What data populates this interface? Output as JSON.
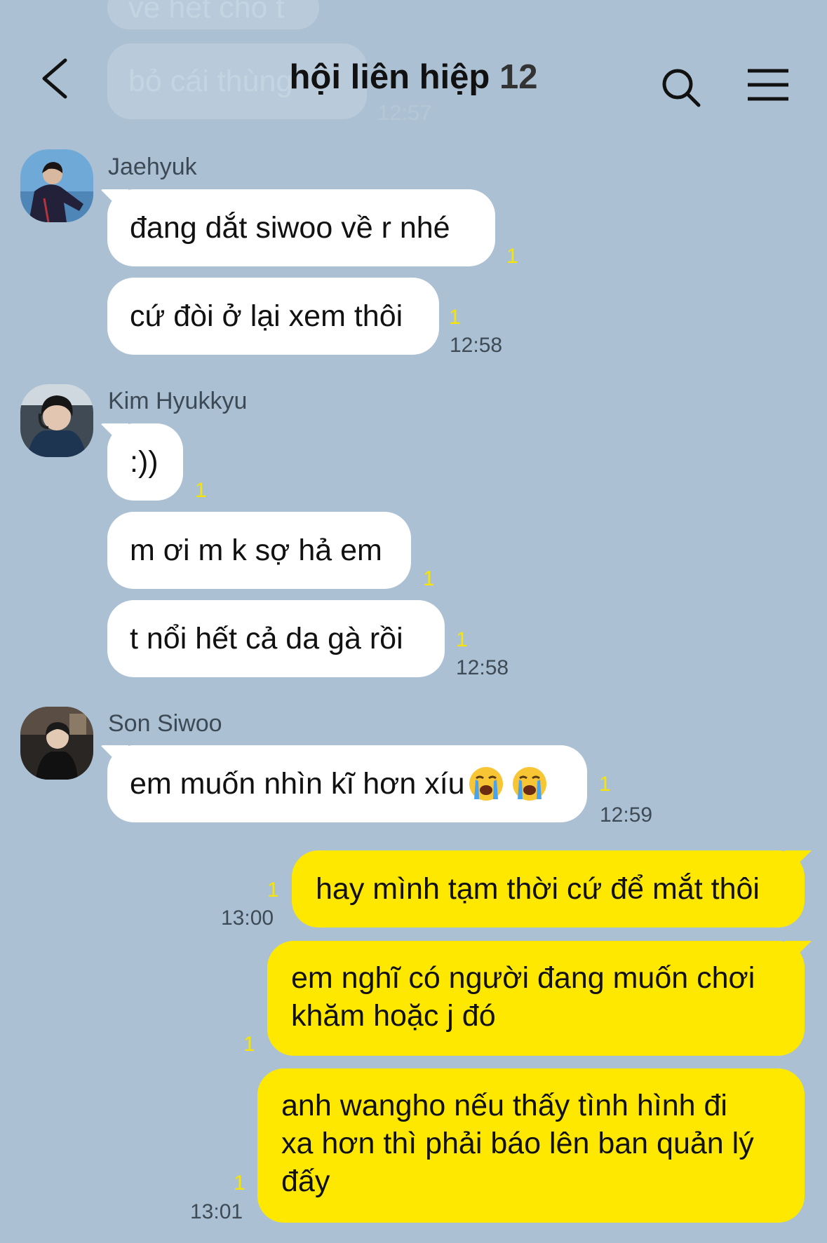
{
  "header": {
    "title": "hội liên hiệp",
    "member_count": "12",
    "back_icon": "chevron-left-icon",
    "search_icon": "search-icon",
    "menu_icon": "menu-icon"
  },
  "faded": {
    "message_1": "về hết cho t",
    "message_2": "bỏ cái thùng",
    "time": "12:57"
  },
  "messages": [
    {
      "sender": "Jaehyuk",
      "bubbles": [
        {
          "text": "đang dắt siwoo về r nhé",
          "unread": "1"
        },
        {
          "text": "cứ đòi ở lại xem thôi",
          "unread": "1",
          "time": "12:58"
        }
      ]
    },
    {
      "sender": "Kim Hyukkyu",
      "bubbles": [
        {
          "text": ":))",
          "unread": "1"
        },
        {
          "text": "m ơi m k sợ hả em",
          "unread": "1"
        },
        {
          "text": "t nổi hết cả da gà rồi",
          "unread": "1",
          "time": "12:58"
        }
      ]
    },
    {
      "sender": "Son Siwoo",
      "bubbles": [
        {
          "text": "em muốn nhìn kĩ hơn xíu",
          "emoji": "loudly-crying-face-icon",
          "unread": "1",
          "time": "12:59"
        }
      ]
    }
  ],
  "mine": [
    {
      "text": "hay mình tạm thời cứ để mắt thôi",
      "unread": "1",
      "time": "13:00"
    },
    {
      "line1": "em nghĩ có người đang muốn chơi",
      "line2": "khăm hoặc j đó",
      "unread": "1"
    },
    {
      "line1": "anh wangho nếu thấy tình hình đi",
      "line2": "xa hơn thì phải báo lên ban quản lý",
      "line3": "đấy",
      "unread": "1",
      "time": "13:01"
    }
  ],
  "colors": {
    "background": "#abc1d3",
    "my_bubble": "#ffe800",
    "their_bubble": "#ffffff",
    "unread": "#f7e400"
  }
}
